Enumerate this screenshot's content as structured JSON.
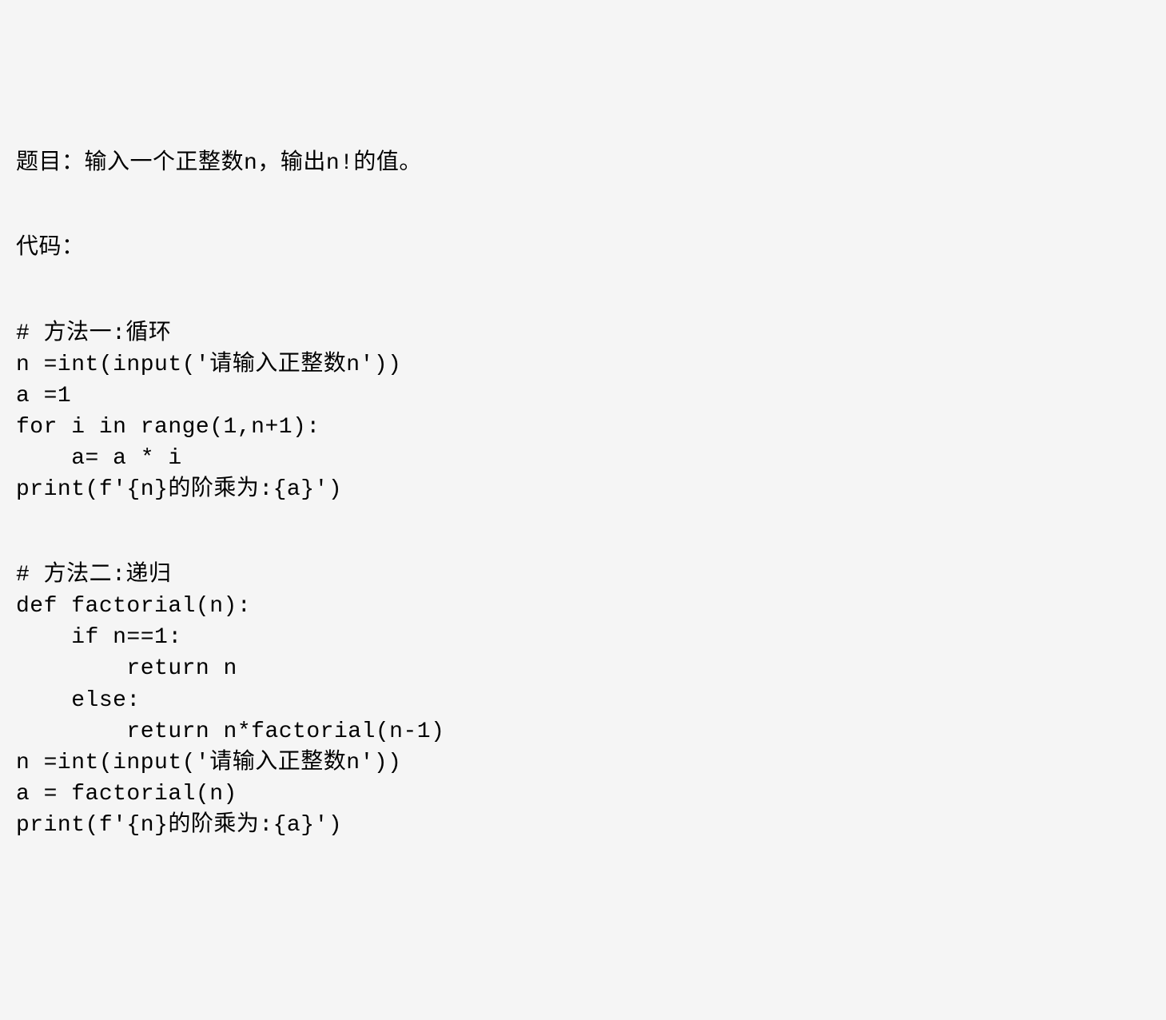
{
  "problem": {
    "label": "题目：",
    "description": "输入一个正整数n，输出n!的值。"
  },
  "code_label": "代码：",
  "method1": {
    "comment": "# 方法一:循环",
    "lines": [
      "n =int(input('请输入正整数n'))",
      "a =1",
      "for i in range(1,n+1):",
      "    a= a * i",
      "print(f'{n}的阶乘为:{a}')"
    ]
  },
  "method2": {
    "comment": "# 方法二:递归",
    "lines": [
      "def factorial(n):",
      "    if n==1:",
      "        return n",
      "    else:",
      "        return n*factorial(n-1)",
      "n =int(input('请输入正整数n'))",
      "a = factorial(n)",
      "print(f'{n}的阶乘为:{a}')"
    ]
  }
}
